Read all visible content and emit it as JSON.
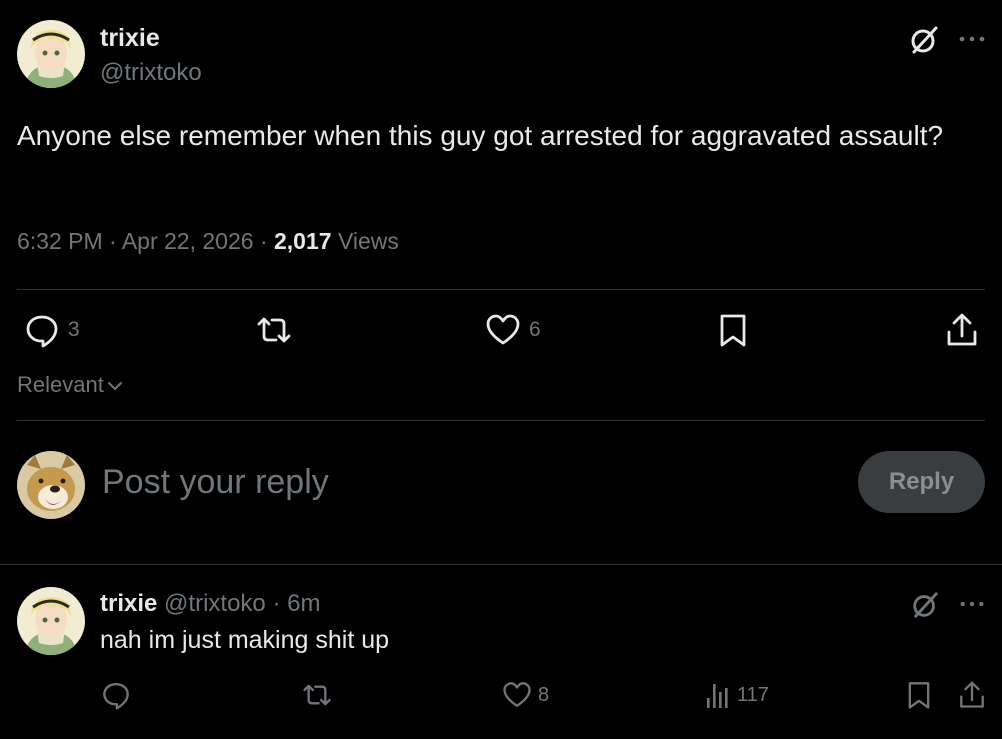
{
  "main_tweet": {
    "author_name": "trixie",
    "author_handle": "@trixtoko",
    "text": "Anyone else remember when this guy got arrested for aggravated assault?",
    "time": "6:32 PM",
    "date": "Apr 22, 2026",
    "views_count": "2,017",
    "views_label": "Views",
    "reply_count": "3",
    "like_count": "6"
  },
  "sort": {
    "label": "Relevant"
  },
  "composer": {
    "placeholder": "Post your reply",
    "reply_button_label": "Reply"
  },
  "reply_tweet": {
    "author_name": "trixie",
    "author_handle": "@trixtoko",
    "age": "6m",
    "text": "nah im just making shit up",
    "like_count": "8",
    "view_count": "117"
  },
  "icons": {
    "reply": "comment-bubble-icon",
    "retweet": "retweet-icon",
    "like": "heart-icon",
    "bookmark": "bookmark-icon",
    "share": "share-upload-icon",
    "views": "bar-chart-icon",
    "grok": "grok-icon",
    "more": "more-dots-icon",
    "chevron": "chevron-down-icon"
  },
  "colors": {
    "background": "#000000",
    "text_primary": "#e7e9ea",
    "text_muted": "#71767b",
    "divider": "#2f3336",
    "reply_button_bg": "#3a3d40"
  }
}
